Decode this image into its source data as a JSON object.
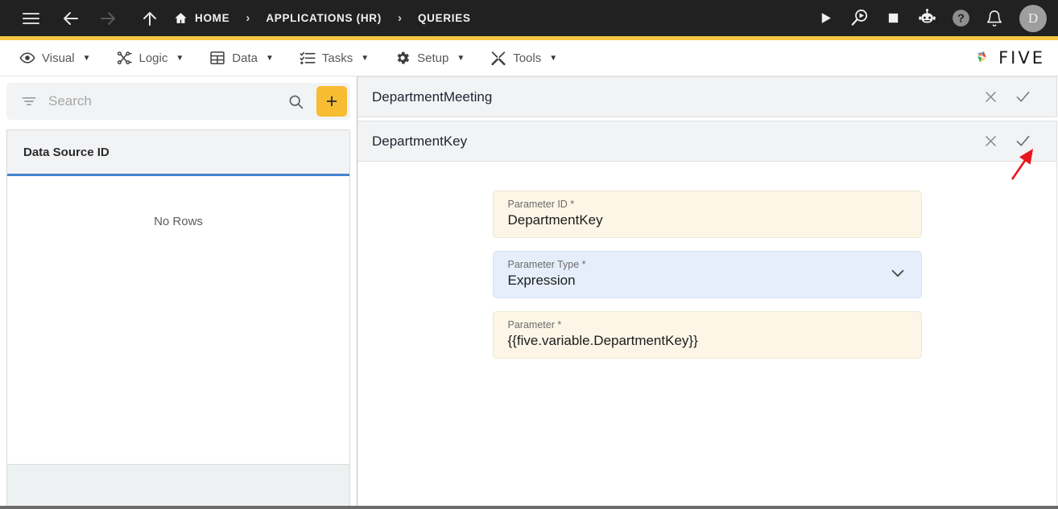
{
  "topbar": {
    "menu_icon": "hamburger-menu-icon",
    "back_icon": "arrow-left-icon",
    "forward_icon": "arrow-right-icon",
    "up_icon": "arrow-up-icon",
    "breadcrumbs": [
      {
        "label": "HOME",
        "icon": "home-icon"
      },
      {
        "label": "APPLICATIONS (HR)",
        "icon": ""
      },
      {
        "label": "QUERIES",
        "icon": ""
      }
    ],
    "separator": "›",
    "actions": [
      {
        "name": "run-icon",
        "title": "Run"
      },
      {
        "name": "debug-icon",
        "title": "Debug"
      },
      {
        "name": "stop-icon",
        "title": "Stop"
      },
      {
        "name": "chatbot-icon",
        "title": "Assistant"
      },
      {
        "name": "help-icon",
        "title": "Help"
      },
      {
        "name": "notifications-bell-icon",
        "title": "Notifications"
      }
    ],
    "avatar_initial": "D",
    "background": "#212121",
    "accent_color": "#f5c542"
  },
  "menubar": {
    "items": [
      {
        "label": "Visual",
        "icon": "eye-icon"
      },
      {
        "label": "Logic",
        "icon": "logic-flow-icon"
      },
      {
        "label": "Data",
        "icon": "table-grid-icon"
      },
      {
        "label": "Tasks",
        "icon": "checklist-icon"
      },
      {
        "label": "Setup",
        "icon": "gear-icon"
      },
      {
        "label": "Tools",
        "icon": "tools-icon"
      }
    ],
    "caret": "▼",
    "brand": "FIVE"
  },
  "sidebar": {
    "search": {
      "placeholder": "Search",
      "value": "",
      "filter_icon": "filter-icon",
      "search_icon": "search-icon"
    },
    "add_button_label": "+",
    "grid": {
      "columns": [
        "Data Source ID"
      ],
      "rows": [],
      "empty_message": "No Rows"
    }
  },
  "main": {
    "panels": [
      {
        "title": "DepartmentMeeting",
        "close_label": "✕",
        "confirm_label": "✓"
      },
      {
        "title": "DepartmentKey",
        "close_label": "✕",
        "confirm_label": "✓"
      }
    ],
    "form": {
      "fields": [
        {
          "label": "Parameter ID *",
          "value": "DepartmentKey",
          "style": "cream",
          "control": "text"
        },
        {
          "label": "Parameter Type *",
          "value": "Expression",
          "style": "blue",
          "control": "select"
        },
        {
          "label": "Parameter *",
          "value": "{{five.variable.DepartmentKey}}",
          "style": "cream",
          "control": "text"
        }
      ]
    }
  },
  "annotation": {
    "arrow_color": "#e8161a",
    "points_to": "confirm-check-button-departmentkey"
  }
}
